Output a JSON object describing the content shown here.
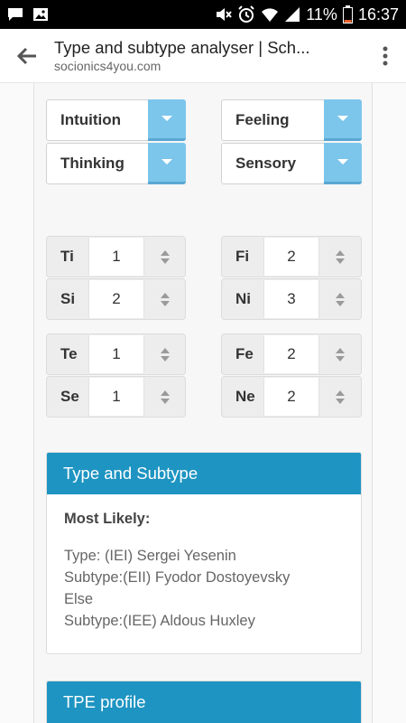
{
  "status_bar": {
    "battery": "11%",
    "time": "16:37",
    "icons": [
      "chat-icon",
      "image-icon",
      "mute-icon",
      "alarm-icon",
      "wifi-icon",
      "signal-icon",
      "battery-icon"
    ]
  },
  "browser": {
    "title": "Type and subtype analyser | Sch...",
    "url": "socionics4you.com"
  },
  "selects": {
    "left": [
      "Intuition",
      "Thinking"
    ],
    "right": [
      "Feeling",
      "Sensory"
    ]
  },
  "functions": {
    "group1": [
      {
        "label": "Ti",
        "value": "1"
      },
      {
        "label": "Si",
        "value": "2"
      },
      {
        "label": "Fi",
        "value": "2"
      },
      {
        "label": "Ni",
        "value": "3"
      }
    ],
    "group2": [
      {
        "label": "Te",
        "value": "1"
      },
      {
        "label": "Se",
        "value": "1"
      },
      {
        "label": "Fe",
        "value": "2"
      },
      {
        "label": "Ne",
        "value": "2"
      }
    ]
  },
  "result_panel": {
    "header": "Type and Subtype",
    "most_likely_label": "Most Likely:",
    "lines": [
      "Type: (IEI) Sergei Yesenin",
      "Subtype:(EII) Fyodor Dostoyevsky",
      "Else",
      "Subtype:(IEE) Aldous Huxley"
    ]
  },
  "tpe_panel": {
    "header": "TPE profile"
  },
  "colors": {
    "accent": "#1e94c2",
    "select_arrow": "#7cc6ec"
  }
}
